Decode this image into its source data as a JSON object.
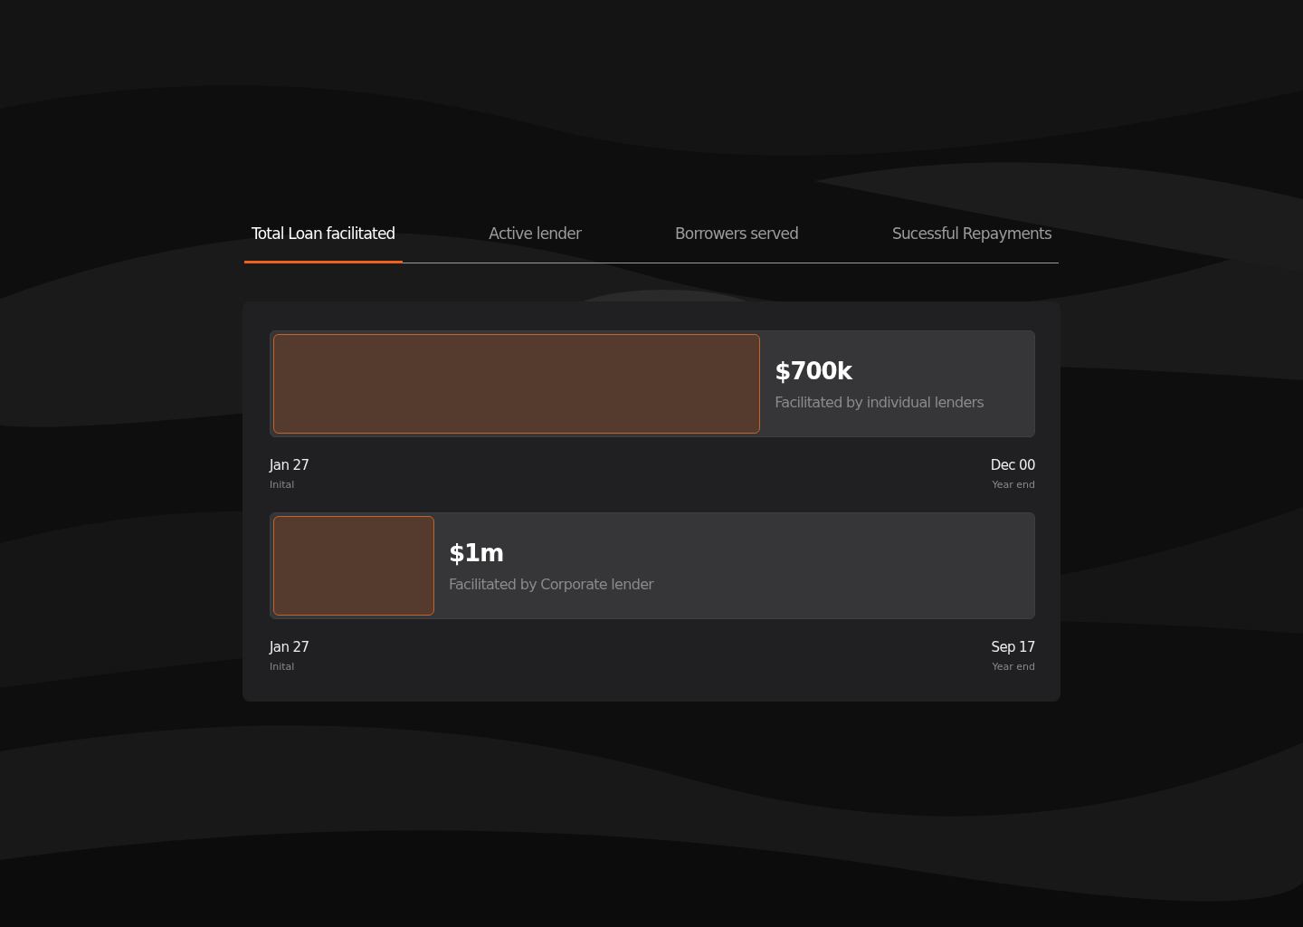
{
  "tabs": [
    {
      "label": "Total Loan facilitated",
      "selected": true
    },
    {
      "label": "Active lender",
      "selected": false
    },
    {
      "label": "Borrowers served",
      "selected": false
    },
    {
      "label": "Sucessful Repayments",
      "selected": false
    }
  ],
  "loans": [
    {
      "level": 0.64,
      "amount": "$700k",
      "caption": "Facilitated by individual lenders",
      "start_date": "Jan 27",
      "start_label": "Inital",
      "end_date": "Dec 00",
      "end_label": "Year end"
    },
    {
      "level": 0.21,
      "amount": "$1m",
      "caption": "Facilitated by Corporate lender",
      "start_date": "Jan 27",
      "start_label": "Inital",
      "end_date": "Sep 17",
      "end_label": "Year end"
    }
  ]
}
